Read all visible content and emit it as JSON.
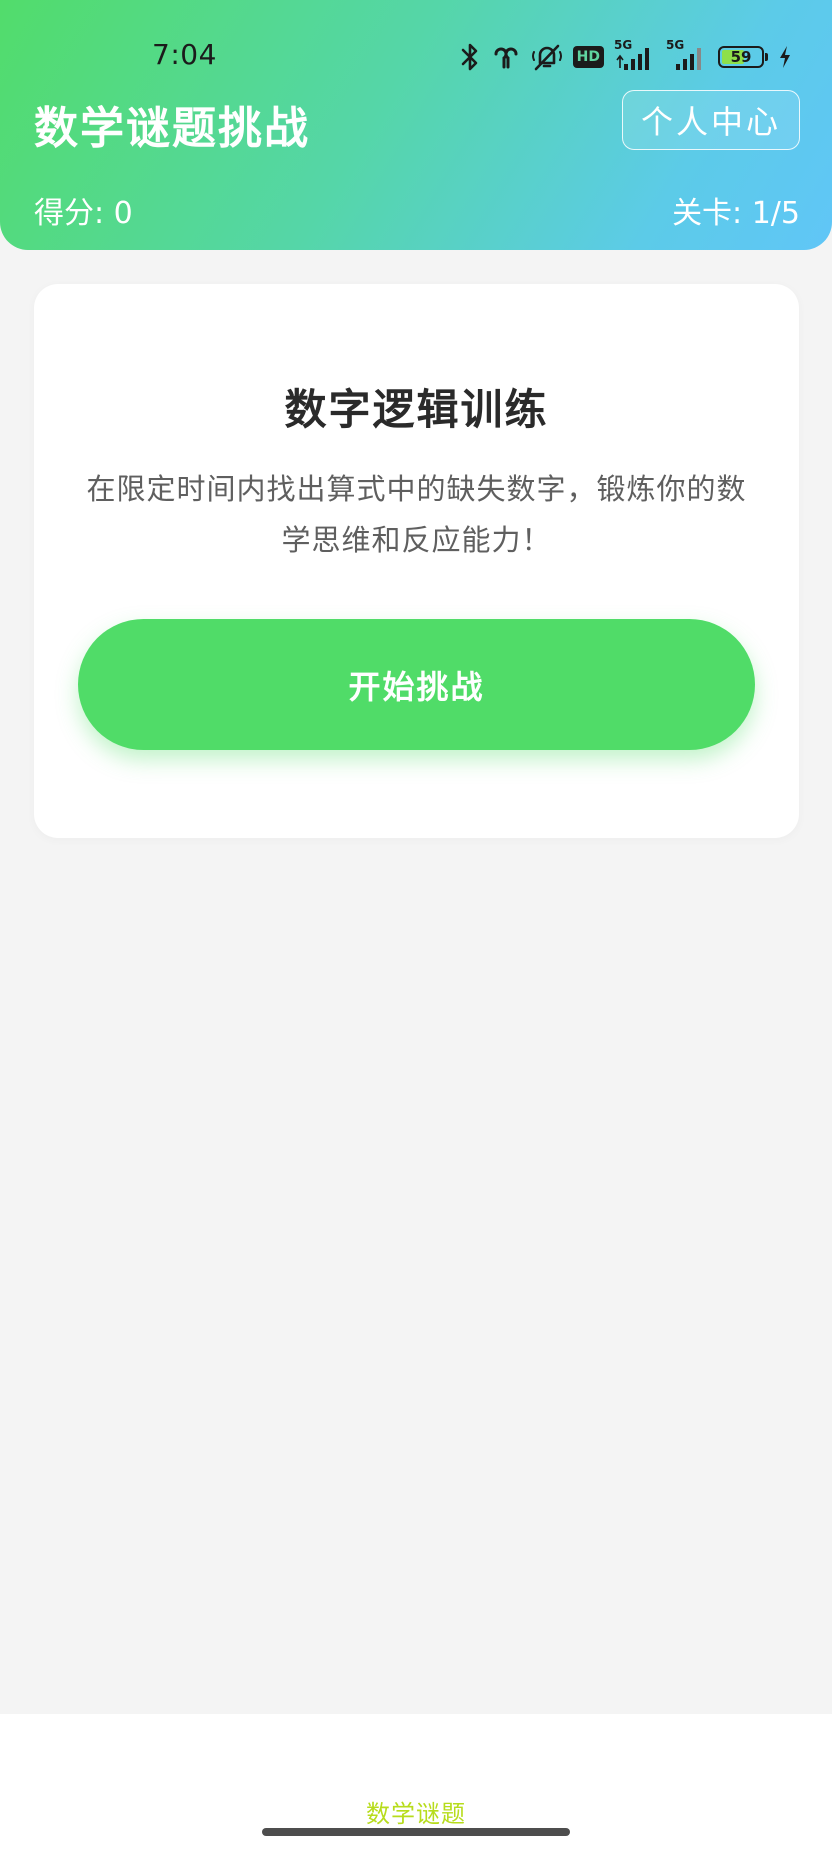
{
  "status_bar": {
    "time": "7:04",
    "hd_label": "HD",
    "network_1": "5G",
    "network_2": "5G",
    "battery_level": "59",
    "battery_fraction": 0.59,
    "battery_color": "#8ee04a"
  },
  "header": {
    "title": "数学谜题挑战",
    "profile_button": "个人中心",
    "score": "得分: 0",
    "level": "关卡: 1/5",
    "gradient_start": "#52dc6b",
    "gradient_end": "#60c6f7"
  },
  "card": {
    "title": "数字逻辑训练",
    "description": "在限定时间内找出算式中的缺失数字，锻炼你的数学思维和反应能力！",
    "start_button": "开始挑战",
    "button_color": "#50dc68"
  },
  "bottom_nav": {
    "items": [
      {
        "label": "数学谜题",
        "active": true,
        "color": "#b7dc1c"
      }
    ]
  },
  "icons": {
    "status": [
      "bluetooth-icon",
      "earbuds-icon",
      "mute-icon",
      "hd-icon",
      "signal-icon",
      "signal-icon",
      "battery-icon",
      "charging-icon"
    ]
  }
}
